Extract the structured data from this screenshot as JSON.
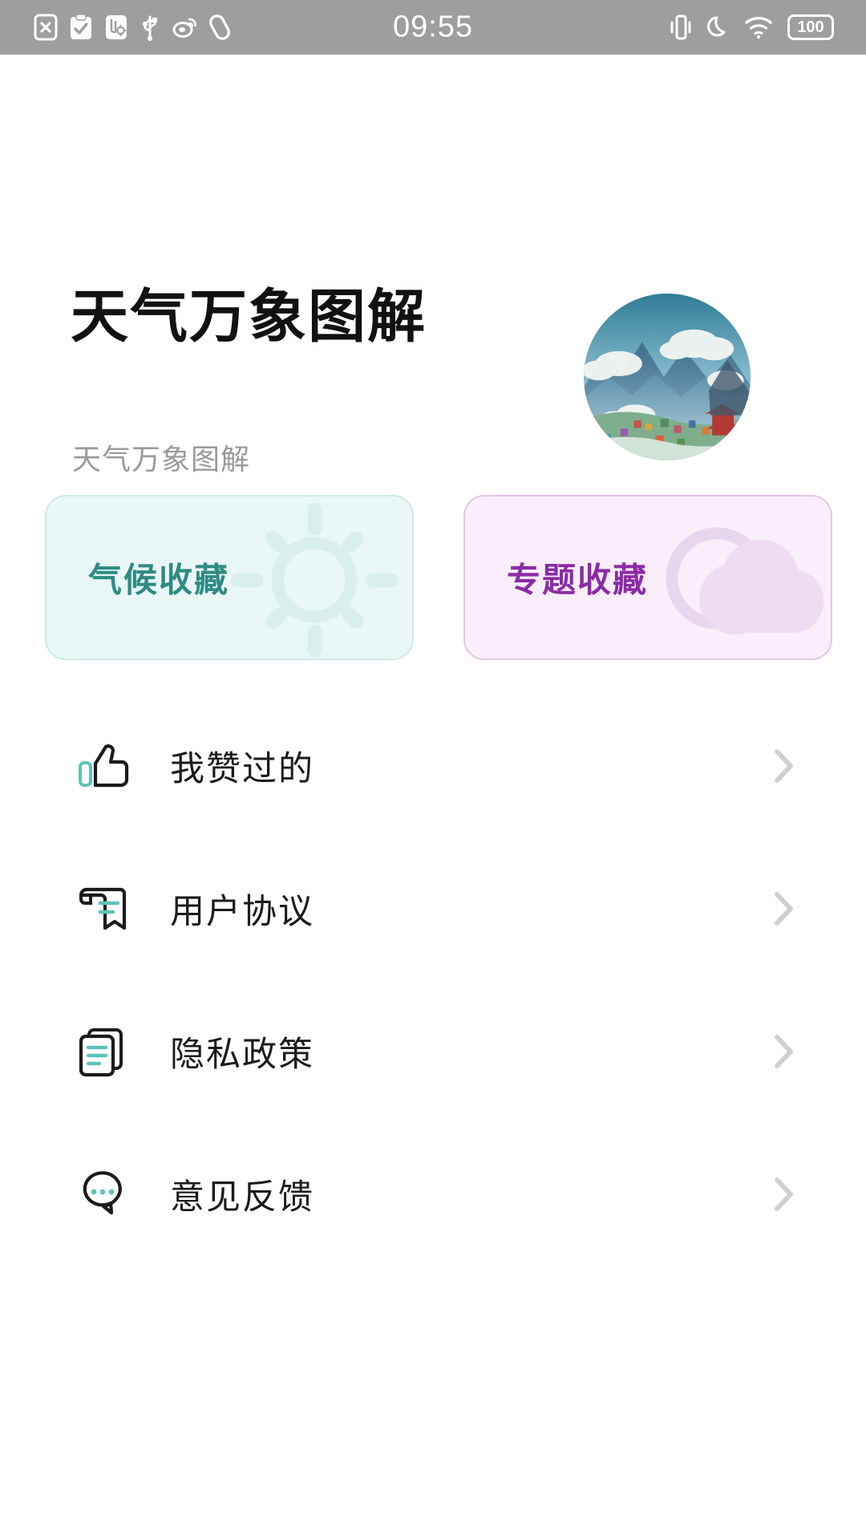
{
  "status_bar": {
    "time": "09:55",
    "battery_text": "100",
    "left_icons": [
      {
        "name": "sim-disabled-icon"
      },
      {
        "name": "task-checklist-icon"
      },
      {
        "name": "developer-options-icon"
      },
      {
        "name": "usb-icon"
      },
      {
        "name": "weibo-icon"
      },
      {
        "name": "capsule-icon"
      }
    ],
    "right_icons": [
      {
        "name": "vibrate-icon"
      },
      {
        "name": "do-not-disturb-moon-icon"
      },
      {
        "name": "wifi-icon"
      },
      {
        "name": "battery-icon"
      }
    ]
  },
  "header": {
    "title": "天气万象图解",
    "subtitle": "天气万象图解",
    "avatar_name": "profile-avatar-landscape"
  },
  "cards": [
    {
      "label": "气候收藏",
      "name": "climate-favorites-card",
      "icon": "sun-icon",
      "bg": "#e9f7f6",
      "border": "#cfe9e6",
      "text_color": "#2e8b83",
      "art_color": "#d9efed"
    },
    {
      "label": "专题收藏",
      "name": "topic-favorites-card",
      "icon": "sun-behind-cloud-icon",
      "bg": "#fbeefb",
      "border": "#e3c6e8",
      "text_color": "#8b2ba6",
      "art_color": "#efdcf2"
    }
  ],
  "list": [
    {
      "label": "我赞过的",
      "icon": "thumbs-up-icon",
      "name": "menu-item-liked"
    },
    {
      "label": "用户协议",
      "icon": "agreement-scroll-icon",
      "name": "menu-item-user-agreement"
    },
    {
      "label": "隐私政策",
      "icon": "privacy-documents-icon",
      "name": "menu-item-privacy-policy"
    },
    {
      "label": "意见反馈",
      "icon": "feedback-chat-icon",
      "name": "menu-item-feedback"
    }
  ],
  "colors": {
    "accent_teal": "#5fc3bb",
    "accent_purple": "#8b2ba6",
    "status_bar_bg": "#9e9e9e",
    "chevron": "#cfcfcf",
    "page_bg": "#ffffff"
  }
}
